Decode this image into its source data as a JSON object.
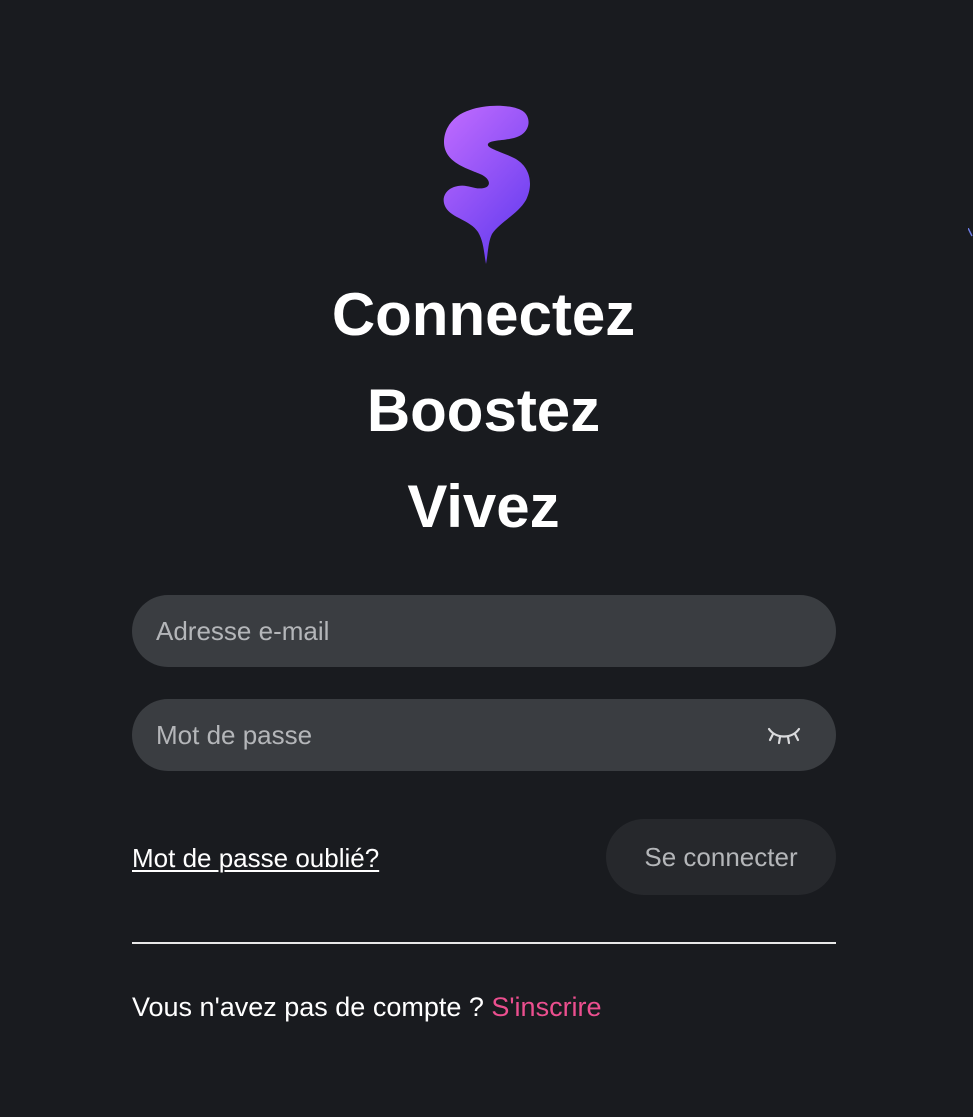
{
  "brand": {
    "logo_icon": "purple-drip-s-logo-icon",
    "gradient_start": "#c26cff",
    "gradient_end": "#6b3ff0"
  },
  "slogan": {
    "line1": "Connectez",
    "line2": "Boostez",
    "line3": "Vivez"
  },
  "form": {
    "email": {
      "placeholder": "Adresse e-mail",
      "value": ""
    },
    "password": {
      "placeholder": "Mot de passe",
      "value": "",
      "toggle_icon": "eye-closed-icon"
    },
    "forgot_password_label": "Mot de passe oublié?",
    "submit_label": "Se connecter"
  },
  "signup": {
    "prompt": "Vous n'avez pas de compte ? ",
    "link_label": "S'inscrire"
  },
  "colors": {
    "background": "#191b1f",
    "field_background": "#3a3d41",
    "button_background": "#26282c",
    "accent_link": "#ec4f8f",
    "muted_text": "#b4b6b9"
  }
}
